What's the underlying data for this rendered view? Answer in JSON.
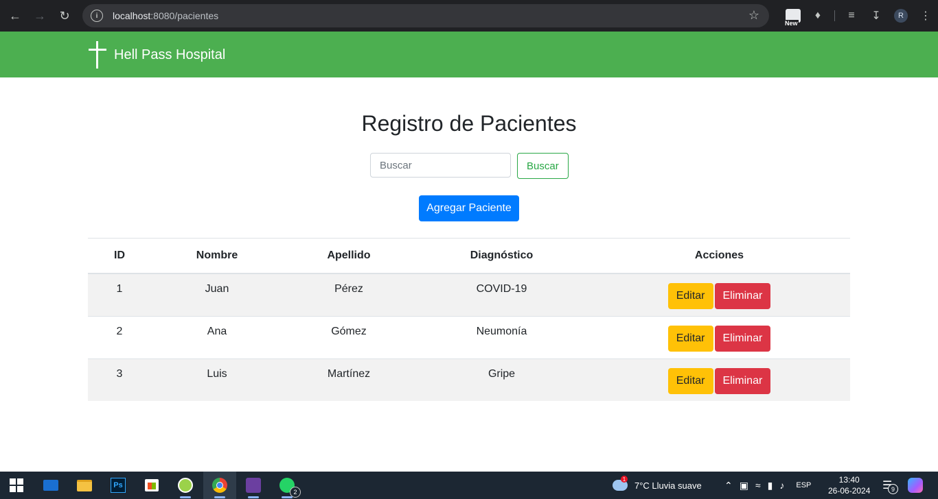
{
  "browser": {
    "url_host": "localhost",
    "url_path": ":8080/pacientes",
    "new_badge": "New",
    "profile_initial": "R",
    "icons": [
      "back-icon",
      "forward-icon",
      "reload-icon",
      "info-icon",
      "star-icon",
      "extensions-icon",
      "reading-list-icon",
      "download-icon"
    ]
  },
  "navbar": {
    "brand": "Hell Pass Hospital",
    "color": "#4caf50"
  },
  "page": {
    "title": "Registro de Pacientes",
    "search_placeholder": "Buscar",
    "search_button": "Buscar",
    "add_button": "Agregar Paciente"
  },
  "table": {
    "headers": {
      "id": "ID",
      "nombre": "Nombre",
      "apellido": "Apellido",
      "diagnostico": "Diagnóstico",
      "acciones": "Acciones"
    },
    "rows": [
      {
        "id": "1",
        "nombre": "Juan",
        "apellido": "Pérez",
        "diagnostico": "COVID-19",
        "edit": "Editar",
        "delete": "Eliminar"
      },
      {
        "id": "2",
        "nombre": "Ana",
        "apellido": "Gómez",
        "diagnostico": "Neumonía",
        "edit": "Editar",
        "delete": "Eliminar"
      },
      {
        "id": "3",
        "nombre": "Luis",
        "apellido": "Martínez",
        "diagnostico": "Gripe",
        "edit": "Editar",
        "delete": "Eliminar"
      }
    ]
  },
  "taskbar": {
    "apps": [
      "windows-start",
      "mail",
      "file-explorer",
      "photoshop",
      "microsoft-store",
      "green-app",
      "chrome",
      "game-app",
      "whatsapp"
    ],
    "ps_label": "Ps",
    "whatsapp_badge": "2",
    "weather_alert": "1",
    "weather": "7°C  Lluvia suave",
    "language": "ESP",
    "time": "13:40",
    "date": "26-06-2024",
    "notifications": "9"
  }
}
